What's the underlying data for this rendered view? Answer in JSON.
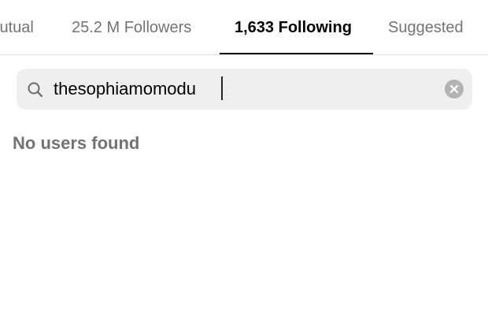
{
  "tabs": [
    {
      "label": "lutual",
      "active": false
    },
    {
      "label": "25.2 M Followers",
      "active": false
    },
    {
      "label": "1,633 Following",
      "active": true
    },
    {
      "label": "Suggested",
      "active": false
    }
  ],
  "search": {
    "value": "thesophiamomodu",
    "icon": "search-icon",
    "clear_icon": "close-icon"
  },
  "results": {
    "empty_message": "No users found"
  },
  "colors": {
    "active_tab": "#000000",
    "inactive_tab": "#737373",
    "search_bg": "#efefef",
    "clear_button_bg": "#b3b3b3"
  }
}
